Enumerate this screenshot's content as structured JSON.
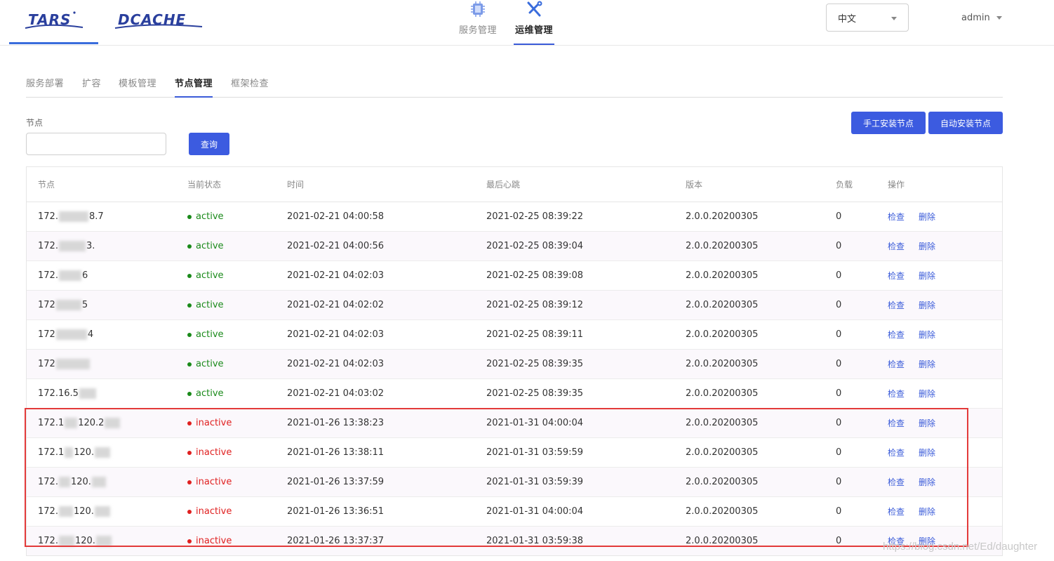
{
  "header": {
    "logo_tars": "TARS",
    "logo_dcache": "DCACHE",
    "nav": [
      {
        "label": "服务管理",
        "icon": "chip-icon",
        "active": false
      },
      {
        "label": "运维管理",
        "icon": "wrench-icon",
        "active": true
      }
    ],
    "language": "中文",
    "user": "admin"
  },
  "tabs": [
    {
      "label": "服务部署",
      "active": false
    },
    {
      "label": "扩容",
      "active": false
    },
    {
      "label": "模板管理",
      "active": false
    },
    {
      "label": "节点管理",
      "active": true
    },
    {
      "label": "框架检查",
      "active": false
    }
  ],
  "filter": {
    "label": "节点",
    "value": "",
    "placeholder": "",
    "query_label": "查询"
  },
  "actions": {
    "manual_install": "手工安装节点",
    "auto_install": "自动安装节点"
  },
  "table": {
    "columns": {
      "node": "节点",
      "status": "当前状态",
      "time": "时间",
      "heartbeat": "最后心跳",
      "version": "版本",
      "load": "负载",
      "ops": "操作"
    },
    "op_check": "检查",
    "op_delete": "删除",
    "rows": [
      {
        "node_a": "172.",
        "node_b": "8.7",
        "status": "active",
        "time": "2021-02-21 04:00:58",
        "heartbeat": "2021-02-25 08:39:22",
        "version": "2.0.0.20200305",
        "load": "0"
      },
      {
        "node_a": "172.",
        "node_b": "3.",
        "status": "active",
        "time": "2021-02-21 04:00:56",
        "heartbeat": "2021-02-25 08:39:04",
        "version": "2.0.0.20200305",
        "load": "0"
      },
      {
        "node_a": "172.",
        "node_b": "6",
        "status": "active",
        "time": "2021-02-21 04:02:03",
        "heartbeat": "2021-02-25 08:39:08",
        "version": "2.0.0.20200305",
        "load": "0"
      },
      {
        "node_a": "172",
        "node_b": "5",
        "status": "active",
        "time": "2021-02-21 04:02:02",
        "heartbeat": "2021-02-25 08:39:12",
        "version": "2.0.0.20200305",
        "load": "0"
      },
      {
        "node_a": "172",
        "node_b": "4",
        "status": "active",
        "time": "2021-02-21 04:02:03",
        "heartbeat": "2021-02-25 08:39:11",
        "version": "2.0.0.20200305",
        "load": "0"
      },
      {
        "node_a": "172",
        "node_b": "",
        "status": "active",
        "time": "2021-02-21 04:02:03",
        "heartbeat": "2021-02-25 08:39:35",
        "version": "2.0.0.20200305",
        "load": "0"
      },
      {
        "node_a": "172.16.5",
        "node_b": "",
        "status": "active",
        "time": "2021-02-21 04:03:02",
        "heartbeat": "2021-02-25 08:39:35",
        "version": "2.0.0.20200305",
        "load": "0"
      },
      {
        "node_a": "172.1",
        "node_b": "120.2",
        "status": "inactive",
        "time": "2021-01-26 13:38:23",
        "heartbeat": "2021-01-31 04:00:04",
        "version": "2.0.0.20200305",
        "load": "0"
      },
      {
        "node_a": "172.1",
        "node_b": "120.",
        "status": "inactive",
        "time": "2021-01-26 13:38:11",
        "heartbeat": "2021-01-31 03:59:59",
        "version": "2.0.0.20200305",
        "load": "0"
      },
      {
        "node_a": "172.",
        "node_b": "120.",
        "status": "inactive",
        "time": "2021-01-26 13:37:59",
        "heartbeat": "2021-01-31 03:59:39",
        "version": "2.0.0.20200305",
        "load": "0"
      },
      {
        "node_a": "172.",
        "node_b": "120.",
        "status": "inactive",
        "time": "2021-01-26 13:36:51",
        "heartbeat": "2021-01-31 04:00:04",
        "version": "2.0.0.20200305",
        "load": "0"
      },
      {
        "node_a": "172.",
        "node_b": "120.",
        "status": "inactive",
        "time": "2021-01-26 13:37:37",
        "heartbeat": "2021-01-31 03:59:38",
        "version": "2.0.0.20200305",
        "load": "0"
      }
    ]
  },
  "colors": {
    "primary": "#3c5be0",
    "active": "#1a8a1a",
    "inactive": "#e02020",
    "highlight": "#e33a3a"
  },
  "watermark": "https://blog.csdn.net/Ed/daughter"
}
